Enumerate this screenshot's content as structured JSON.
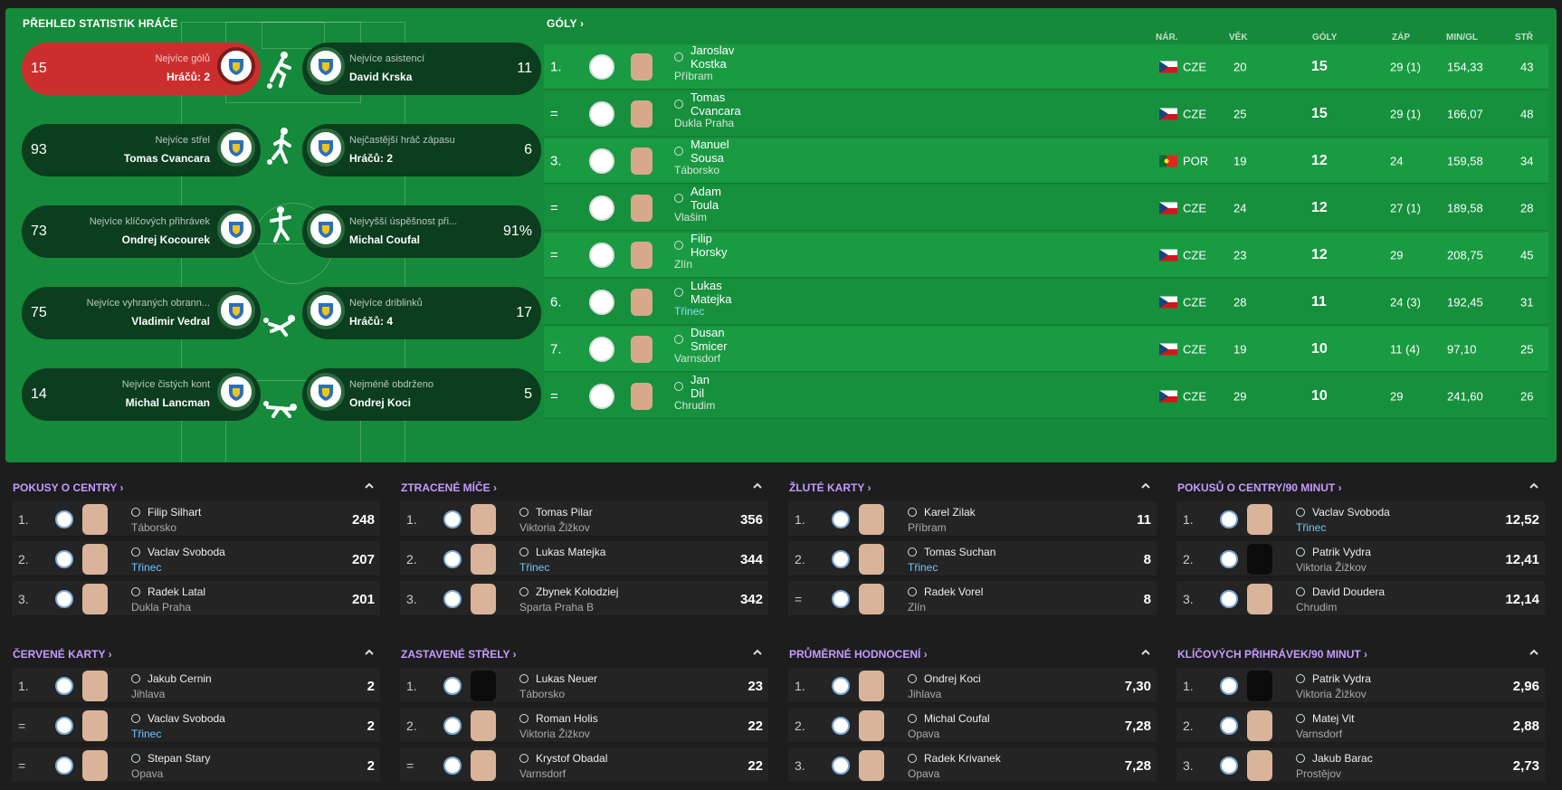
{
  "overview": {
    "title": "PŘEHLED STATISTIK HRÁČE",
    "tiles": [
      {
        "side": "left",
        "value": "15",
        "label": "Nejvíce gólů",
        "name": "Hráčů: 2",
        "highlight": true
      },
      {
        "side": "right",
        "value": "11",
        "label": "Nejvíce asistencí",
        "name": "David Krska"
      },
      {
        "side": "left",
        "value": "93",
        "label": "Nejvíce střel",
        "name": "Tomas Cvancara"
      },
      {
        "side": "right",
        "value": "6",
        "label": "Nejčastější hráč zápasu",
        "name": "Hráčů: 2"
      },
      {
        "side": "left",
        "value": "73",
        "label": "Nejvíce klíčových přihrávek",
        "name": "Ondrej Kocourek"
      },
      {
        "side": "right",
        "value": "91%",
        "label": "Nejvyšší úspěšnost při...",
        "name": "Michal Coufal"
      },
      {
        "side": "left",
        "value": "75",
        "label": "Nejvíce vyhraných obrann...",
        "name": "Vladimir Vedral"
      },
      {
        "side": "right",
        "value": "17",
        "label": "Nejvíce driblinků",
        "name": "Hráčů: 4"
      },
      {
        "side": "left",
        "value": "14",
        "label": "Nejvíce čistých kont",
        "name": "Michal Lancman"
      },
      {
        "side": "right",
        "value": "5",
        "label": "Nejméně obdrženo",
        "name": "Ondrej Koci"
      }
    ]
  },
  "goals": {
    "title": "GÓLY",
    "columns": {
      "nat": "NÁR.",
      "age": "VĚK",
      "goals": "GÓLY",
      "apps": "ZÁP",
      "mpg": "MIN/GL",
      "shots": "STŘ"
    },
    "rows": [
      {
        "rank": "1.",
        "name": "Jaroslav Kostka",
        "club": "Příbram",
        "nat": "CZE",
        "age": "20",
        "goals": "15",
        "apps": "29 (1)",
        "mpg": "154,33",
        "shots": "43",
        "flag": "cz"
      },
      {
        "rank": "=",
        "name": "Tomas Cvancara",
        "club": "Dukla Praha",
        "nat": "CZE",
        "age": "25",
        "goals": "15",
        "apps": "29 (1)",
        "mpg": "166,07",
        "shots": "48",
        "flag": "cz"
      },
      {
        "rank": "3.",
        "name": "Manuel Sousa",
        "club": "Táborsko",
        "nat": "POR",
        "age": "19",
        "goals": "12",
        "apps": "24",
        "mpg": "159,58",
        "shots": "34",
        "flag": "pt"
      },
      {
        "rank": "=",
        "name": "Adam Toula",
        "club": "Vlašim",
        "nat": "CZE",
        "age": "24",
        "goals": "12",
        "apps": "27 (1)",
        "mpg": "189,58",
        "shots": "28",
        "flag": "cz"
      },
      {
        "rank": "=",
        "name": "Filip Horsky",
        "club": "Zlín",
        "nat": "CZE",
        "age": "23",
        "goals": "12",
        "apps": "29",
        "mpg": "208,75",
        "shots": "45",
        "flag": "cz"
      },
      {
        "rank": "6.",
        "name": "Lukas Matejka",
        "club": "Třinec",
        "nat": "CZE",
        "age": "28",
        "goals": "11",
        "apps": "24 (3)",
        "mpg": "192,45",
        "shots": "31",
        "flag": "cz",
        "club_link": true
      },
      {
        "rank": "7.",
        "name": "Dusan Smicer",
        "club": "Varnsdorf",
        "nat": "CZE",
        "age": "19",
        "goals": "10",
        "apps": "11 (4)",
        "mpg": "97,10",
        "shots": "25",
        "flag": "cz"
      },
      {
        "rank": "=",
        "name": "Jan Dil",
        "club": "Chrudim",
        "nat": "CZE",
        "age": "29",
        "goals": "10",
        "apps": "29",
        "mpg": "241,60",
        "shots": "26",
        "flag": "cz"
      }
    ]
  },
  "panels": [
    {
      "title": "POKUSY O CENTRY",
      "rows": [
        {
          "rank": "1.",
          "name": "Filip Silhart",
          "club": "Táborsko",
          "value": "248"
        },
        {
          "rank": "2.",
          "name": "Vaclav Svoboda",
          "club": "Třinec",
          "value": "207",
          "club_link": true
        },
        {
          "rank": "3.",
          "name": "Radek Latal",
          "club": "Dukla Praha",
          "value": "201"
        }
      ]
    },
    {
      "title": "ZTRACENÉ MÍČE",
      "rows": [
        {
          "rank": "1.",
          "name": "Tomas Pilar",
          "club": "Viktoria Žižkov",
          "value": "356"
        },
        {
          "rank": "2.",
          "name": "Lukas Matejka",
          "club": "Třinec",
          "value": "344",
          "club_link": true
        },
        {
          "rank": "3.",
          "name": "Zbynek Kolodziej",
          "club": "Sparta Praha B",
          "value": "342"
        }
      ]
    },
    {
      "title": "ŽLUTÉ KARTY",
      "rows": [
        {
          "rank": "1.",
          "name": "Karel Zilak",
          "club": "Příbram",
          "value": "11"
        },
        {
          "rank": "2.",
          "name": "Tomas Suchan",
          "club": "Třinec",
          "value": "8",
          "club_link": true
        },
        {
          "rank": "=",
          "name": "Radek Vorel",
          "club": "Zlín",
          "value": "8"
        }
      ]
    },
    {
      "title": "POKUSŮ O CENTRY/90 MINUT",
      "rows": [
        {
          "rank": "1.",
          "name": "Vaclav Svoboda",
          "club": "Třinec",
          "value": "12,52",
          "club_link": true
        },
        {
          "rank": "2.",
          "name": "Patrik Vydra",
          "club": "Viktoria Žižkov",
          "value": "12,41",
          "silhouette": true
        },
        {
          "rank": "3.",
          "name": "David Doudera",
          "club": "Chrudim",
          "value": "12,14"
        }
      ]
    },
    {
      "title": "ČERVENÉ KARTY",
      "rows": [
        {
          "rank": "1.",
          "name": "Jakub Cernin",
          "club": "Jihlava",
          "value": "2"
        },
        {
          "rank": "=",
          "name": "Vaclav Svoboda",
          "club": "Třinec",
          "value": "2",
          "club_link": true
        },
        {
          "rank": "=",
          "name": "Stepan Stary",
          "club": "Opava",
          "value": "2"
        }
      ]
    },
    {
      "title": "ZASTAVENÉ STŘELY",
      "rows": [
        {
          "rank": "1.",
          "name": "Lukas Neuer",
          "club": "Táborsko",
          "value": "23",
          "silhouette": true
        },
        {
          "rank": "2.",
          "name": "Roman Holis",
          "club": "Viktoria Žižkov",
          "value": "22"
        },
        {
          "rank": "=",
          "name": "Krystof Obadal",
          "club": "Varnsdorf",
          "value": "22"
        }
      ]
    },
    {
      "title": "PRŮMĚRNÉ HODNOCENÍ",
      "rows": [
        {
          "rank": "1.",
          "name": "Ondrej Koci",
          "club": "Jihlava",
          "value": "7,30"
        },
        {
          "rank": "2.",
          "name": "Michal Coufal",
          "club": "Opava",
          "value": "7,28"
        },
        {
          "rank": "3.",
          "name": "Radek Krivanek",
          "club": "Opava",
          "value": "7,28"
        }
      ]
    },
    {
      "title": "KLÍČOVÝCH PŘIHRÁVEK/90 MINUT",
      "rows": [
        {
          "rank": "1.",
          "name": "Patrik Vydra",
          "club": "Viktoria Žižkov",
          "value": "2,96",
          "silhouette": true
        },
        {
          "rank": "2.",
          "name": "Matej Vit",
          "club": "Varnsdorf",
          "value": "2,88"
        },
        {
          "rank": "3.",
          "name": "Jakub Barac",
          "club": "Prostějov",
          "value": "2,73"
        }
      ]
    }
  ],
  "icons": {
    "chevron_right": "chevron-right-icon",
    "chevron_up": "chevron-up-icon",
    "player": "player-icon"
  },
  "colors": {
    "panel_green": "#158a3a",
    "highlight_red": "#cc2e2e",
    "title_purple": "#c59bff",
    "link_blue": "#6cc6ff"
  }
}
